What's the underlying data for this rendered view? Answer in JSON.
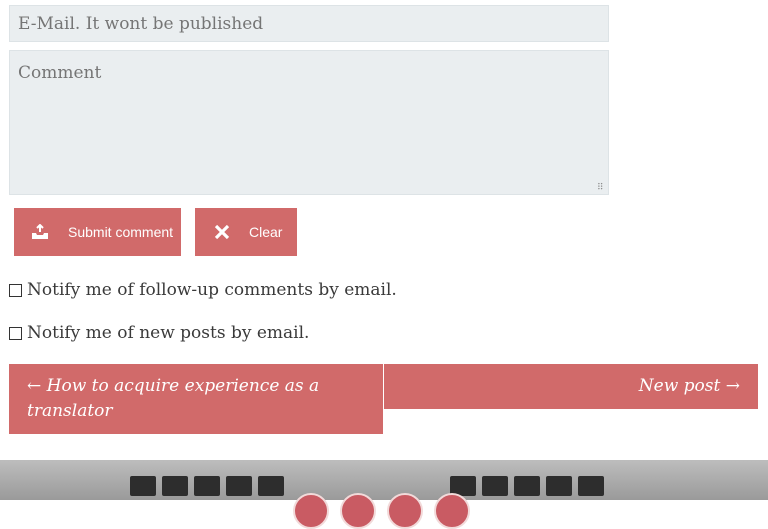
{
  "form": {
    "email_placeholder": "E-Mail. It wont be published",
    "comment_placeholder": "Comment",
    "submit_label": "Submit comment",
    "clear_label": "Clear",
    "notify_followup_label": "Notify me of follow-up comments by email.",
    "notify_new_posts_label": "Notify me of new posts by email."
  },
  "post_nav": {
    "prev_label": "← How to acquire experience as a translator",
    "next_label": "New post →"
  },
  "icons": {
    "submit": "inbox-upload-icon",
    "clear": "close-x-icon",
    "social": [
      "social-icon",
      "social-icon",
      "social-icon",
      "social-icon"
    ]
  },
  "colors": {
    "accent": "#d16a6a",
    "field_bg": "#eaeef0",
    "placeholder": "#9aa5ab"
  }
}
